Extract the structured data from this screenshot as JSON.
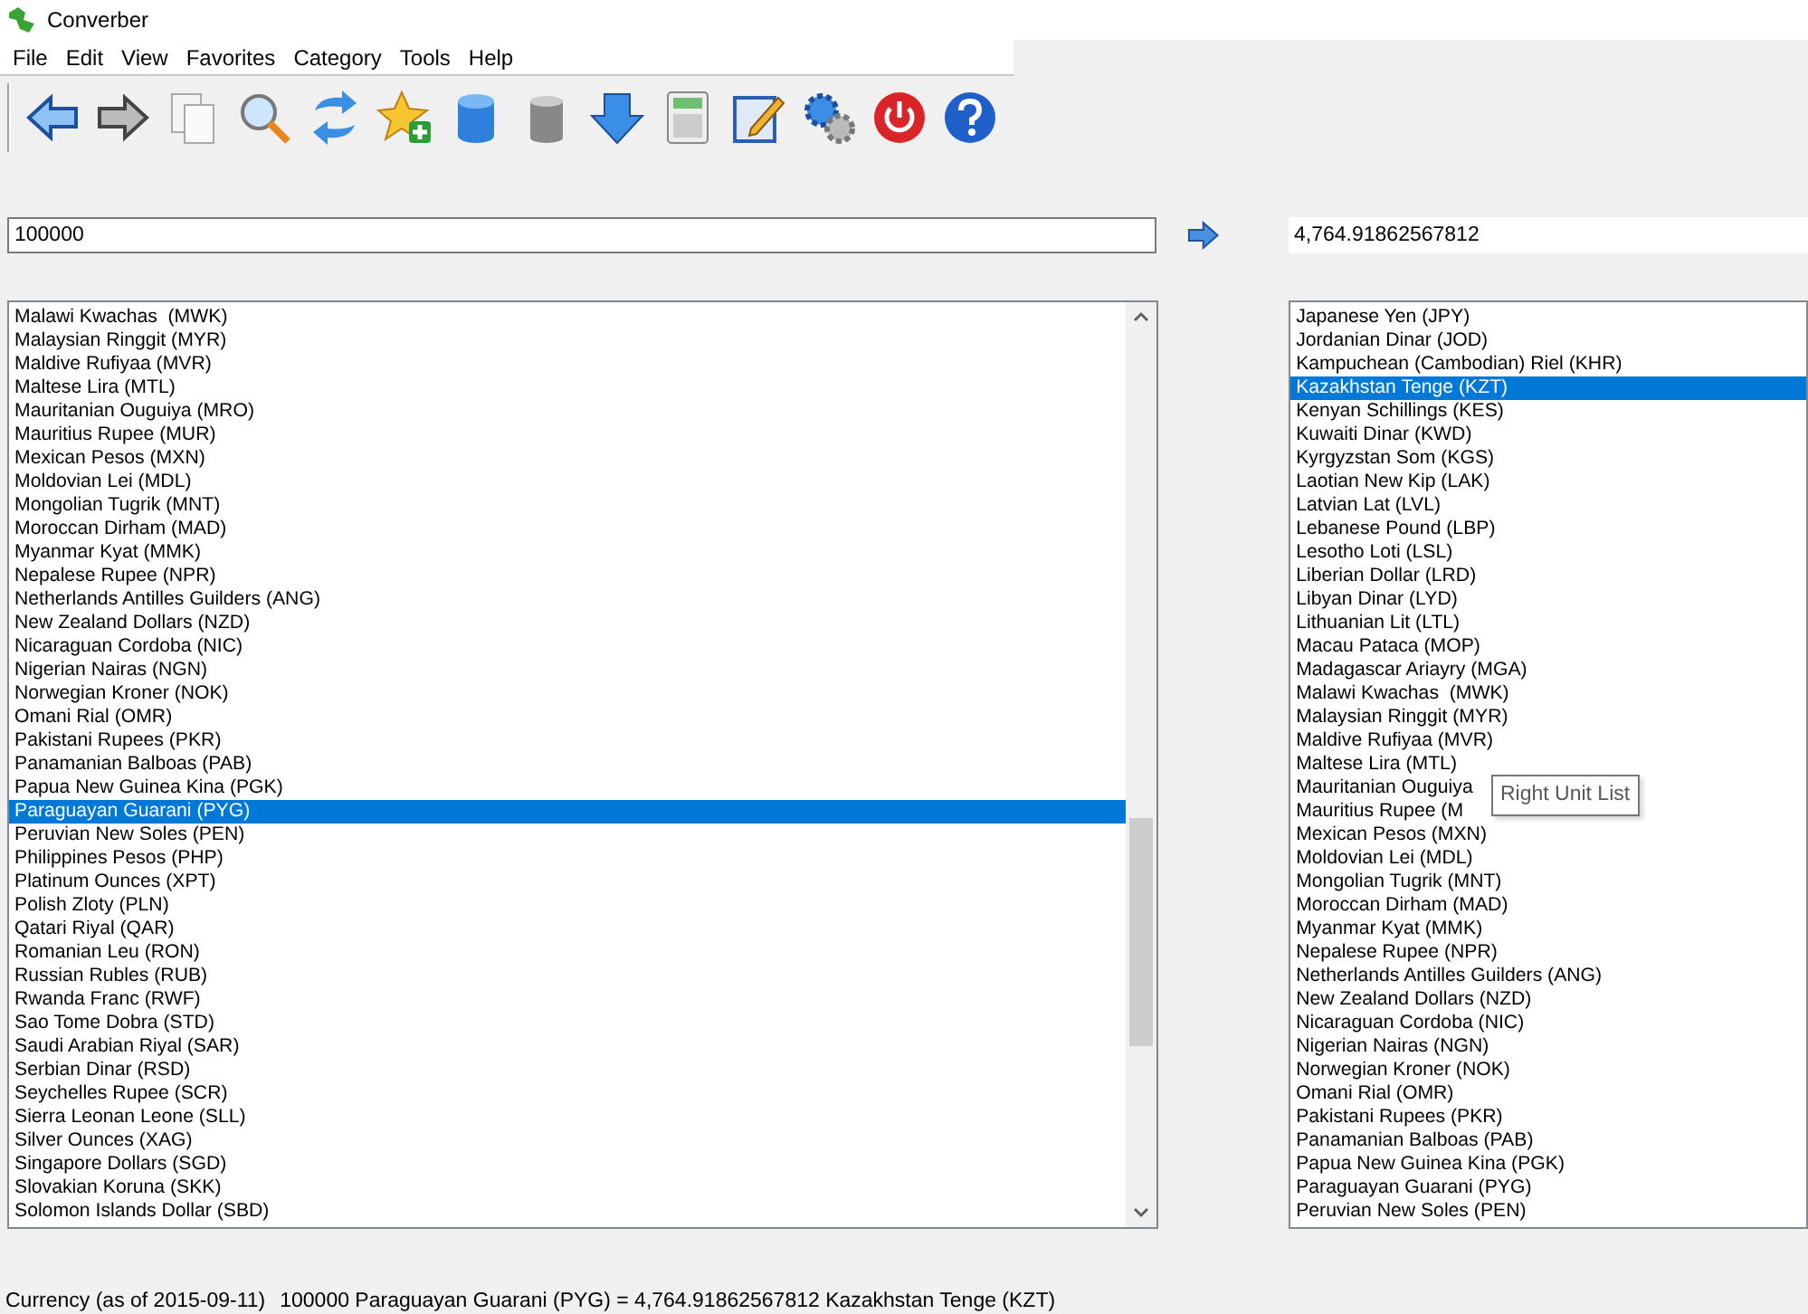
{
  "window": {
    "title": "Converber"
  },
  "menu": [
    "File",
    "Edit",
    "View",
    "Favorites",
    "Category",
    "Tools",
    "Help"
  ],
  "input": {
    "value": "100000"
  },
  "output": {
    "value": "4,764.91862567812"
  },
  "left_list": {
    "items": [
      {
        "label": "Malawi Kwachas  (MWK)",
        "selected": false
      },
      {
        "label": "Malaysian Ringgit (MYR)",
        "selected": false
      },
      {
        "label": "Maldive Rufiyaa (MVR)",
        "selected": false
      },
      {
        "label": "Maltese Lira (MTL)",
        "selected": false
      },
      {
        "label": "Mauritanian Ouguiya (MRO)",
        "selected": false
      },
      {
        "label": "Mauritius Rupee (MUR)",
        "selected": false
      },
      {
        "label": "Mexican Pesos (MXN)",
        "selected": false
      },
      {
        "label": "Moldovian Lei (MDL)",
        "selected": false
      },
      {
        "label": "Mongolian Tugrik (MNT)",
        "selected": false
      },
      {
        "label": "Moroccan Dirham (MAD)",
        "selected": false
      },
      {
        "label": "Myanmar Kyat (MMK)",
        "selected": false
      },
      {
        "label": "Nepalese Rupee (NPR)",
        "selected": false
      },
      {
        "label": "Netherlands Antilles Guilders (ANG)",
        "selected": false
      },
      {
        "label": "New Zealand Dollars (NZD)",
        "selected": false
      },
      {
        "label": "Nicaraguan Cordoba (NIC)",
        "selected": false
      },
      {
        "label": "Nigerian Nairas (NGN)",
        "selected": false
      },
      {
        "label": "Norwegian Kroner (NOK)",
        "selected": false
      },
      {
        "label": "Omani Rial (OMR)",
        "selected": false
      },
      {
        "label": "Pakistani Rupees (PKR)",
        "selected": false
      },
      {
        "label": "Panamanian Balboas (PAB)",
        "selected": false
      },
      {
        "label": "Papua New Guinea Kina (PGK)",
        "selected": false
      },
      {
        "label": "Paraguayan Guarani (PYG)",
        "selected": true
      },
      {
        "label": "Peruvian New Soles (PEN)",
        "selected": false
      },
      {
        "label": "Philippines Pesos (PHP)",
        "selected": false
      },
      {
        "label": "Platinum Ounces (XPT)",
        "selected": false
      },
      {
        "label": "Polish Zloty (PLN)",
        "selected": false
      },
      {
        "label": "Qatari Riyal (QAR)",
        "selected": false
      },
      {
        "label": "Romanian Leu (RON)",
        "selected": false
      },
      {
        "label": "Russian Rubles (RUB)",
        "selected": false
      },
      {
        "label": "Rwanda Franc (RWF)",
        "selected": false
      },
      {
        "label": "Sao Tome Dobra (STD)",
        "selected": false
      },
      {
        "label": "Saudi Arabian Riyal (SAR)",
        "selected": false
      },
      {
        "label": "Serbian Dinar (RSD)",
        "selected": false
      },
      {
        "label": "Seychelles Rupee (SCR)",
        "selected": false
      },
      {
        "label": "Sierra Leonan Leone (SLL)",
        "selected": false
      },
      {
        "label": "Silver Ounces (XAG)",
        "selected": false
      },
      {
        "label": "Singapore Dollars (SGD)",
        "selected": false
      },
      {
        "label": "Slovakian Koruna (SKK)",
        "selected": false
      },
      {
        "label": "Solomon Islands Dollar (SBD)",
        "selected": false
      }
    ]
  },
  "right_list": {
    "items": [
      {
        "label": "Japanese Yen (JPY)",
        "selected": false
      },
      {
        "label": "Jordanian Dinar (JOD)",
        "selected": false
      },
      {
        "label": "Kampuchean (Cambodian) Riel (KHR)",
        "selected": false
      },
      {
        "label": "Kazakhstan Tenge (KZT)",
        "selected": true
      },
      {
        "label": "Kenyan Schillings (KES)",
        "selected": false
      },
      {
        "label": "Kuwaiti Dinar (KWD)",
        "selected": false
      },
      {
        "label": "Kyrgyzstan Som (KGS)",
        "selected": false
      },
      {
        "label": "Laotian New Kip (LAK)",
        "selected": false
      },
      {
        "label": "Latvian Lat (LVL)",
        "selected": false
      },
      {
        "label": "Lebanese Pound (LBP)",
        "selected": false
      },
      {
        "label": "Lesotho Loti (LSL)",
        "selected": false
      },
      {
        "label": "Liberian Dollar (LRD)",
        "selected": false
      },
      {
        "label": "Libyan Dinar (LYD)",
        "selected": false
      },
      {
        "label": "Lithuanian Lit (LTL)",
        "selected": false
      },
      {
        "label": "Macau Pataca (MOP)",
        "selected": false
      },
      {
        "label": "Madagascar Ariayry (MGA)",
        "selected": false
      },
      {
        "label": "Malawi Kwachas  (MWK)",
        "selected": false
      },
      {
        "label": "Malaysian Ringgit (MYR)",
        "selected": false
      },
      {
        "label": "Maldive Rufiyaa (MVR)",
        "selected": false
      },
      {
        "label": "Maltese Lira (MTL)",
        "selected": false
      },
      {
        "label": "Mauritanian Ouguiya",
        "selected": false
      },
      {
        "label": "Mauritius Rupee (M",
        "selected": false
      },
      {
        "label": "Mexican Pesos (MXN)",
        "selected": false
      },
      {
        "label": "Moldovian Lei (MDL)",
        "selected": false
      },
      {
        "label": "Mongolian Tugrik (MNT)",
        "selected": false
      },
      {
        "label": "Moroccan Dirham (MAD)",
        "selected": false
      },
      {
        "label": "Myanmar Kyat (MMK)",
        "selected": false
      },
      {
        "label": "Nepalese Rupee (NPR)",
        "selected": false
      },
      {
        "label": "Netherlands Antilles Guilders (ANG)",
        "selected": false
      },
      {
        "label": "New Zealand Dollars (NZD)",
        "selected": false
      },
      {
        "label": "Nicaraguan Cordoba (NIC)",
        "selected": false
      },
      {
        "label": "Nigerian Nairas (NGN)",
        "selected": false
      },
      {
        "label": "Norwegian Kroner (NOK)",
        "selected": false
      },
      {
        "label": "Omani Rial (OMR)",
        "selected": false
      },
      {
        "label": "Pakistani Rupees (PKR)",
        "selected": false
      },
      {
        "label": "Panamanian Balboas (PAB)",
        "selected": false
      },
      {
        "label": "Papua New Guinea Kina (PGK)",
        "selected": false
      },
      {
        "label": "Paraguayan Guarani (PYG)",
        "selected": false
      },
      {
        "label": "Peruvian New Soles (PEN)",
        "selected": false
      }
    ]
  },
  "tooltip": {
    "text": "Right Unit List"
  },
  "status_bar": {
    "category": "Currency (as of 2015-09-11)",
    "result": "100000 Paraguayan Guarani (PYG) = 4,764.91862567812 Kazakhstan Tenge (KZT)"
  }
}
